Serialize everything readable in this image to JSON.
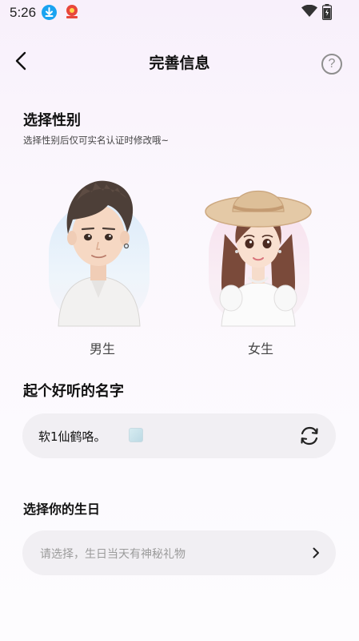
{
  "status_bar": {
    "time": "5:26"
  },
  "header": {
    "title": "完善信息",
    "help_glyph": "?"
  },
  "gender": {
    "title": "选择性别",
    "subtitle": "选择性别后仅可实名认证时修改哦~",
    "options": [
      {
        "label": "男生"
      },
      {
        "label": "女生"
      }
    ]
  },
  "name": {
    "title": "起个好听的名字",
    "value": "软1仙鹤咯。"
  },
  "birthday": {
    "title": "选择你的生日",
    "placeholder": "请选择，生日当天有神秘礼物"
  },
  "icons": [
    "download-icon",
    "app-notification-icon",
    "wifi-icon",
    "battery-icon",
    "back-arrow-icon",
    "help-icon",
    "refresh-icon",
    "chevron-right-icon"
  ]
}
